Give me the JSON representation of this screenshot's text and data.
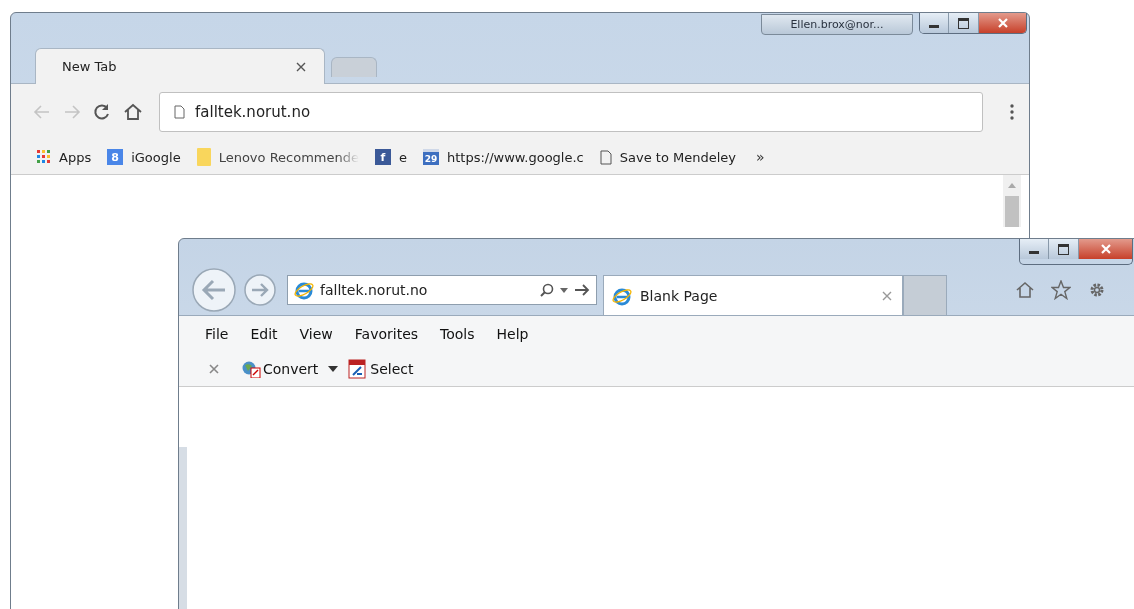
{
  "chrome": {
    "profile": "Ellen.brox@nor...",
    "tab": {
      "label": "New Tab"
    },
    "address": "falltek.norut.no",
    "bookmarks": [
      {
        "kind": "apps",
        "label": "Apps"
      },
      {
        "kind": "google",
        "label": "iGoogle",
        "icon_text": "8"
      },
      {
        "kind": "folder",
        "label": "Lenovo Recommende"
      },
      {
        "kind": "facebook",
        "label": "e",
        "icon_text": "f"
      },
      {
        "kind": "calendar",
        "label": "https://www.google.c",
        "icon_text": "29"
      },
      {
        "kind": "page",
        "label": "Save to Mendeley"
      }
    ],
    "overflow": "»"
  },
  "ie": {
    "address": "falltek.norut.no",
    "tab": {
      "label": "Blank Page"
    },
    "menu": [
      "File",
      "Edit",
      "View",
      "Favorites",
      "Tools",
      "Help"
    ],
    "toolbar": [
      {
        "kind": "convert",
        "label": "Convert"
      },
      {
        "kind": "select",
        "label": "Select"
      }
    ]
  }
}
